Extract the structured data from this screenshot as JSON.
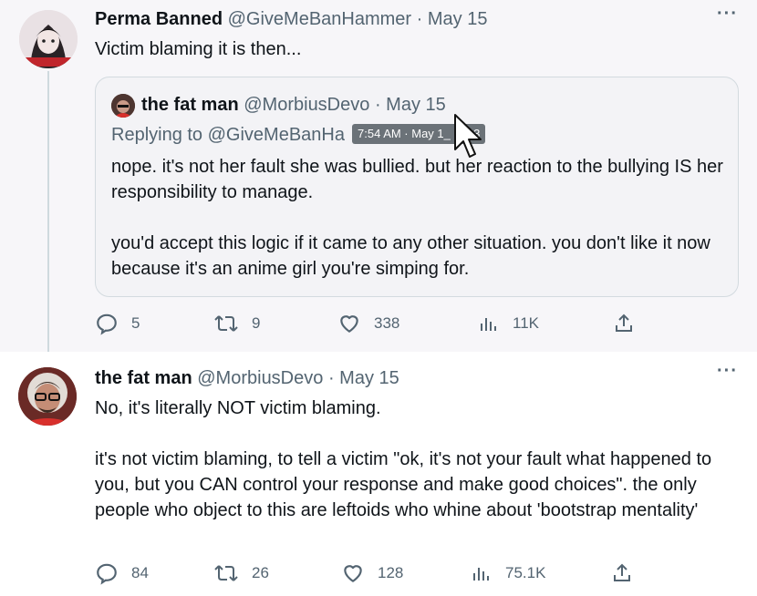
{
  "tweets": [
    {
      "author_name": "Perma Banned",
      "handle": "@GiveMeBanHammer",
      "date": "May 15",
      "text": "Victim blaming it is then...",
      "quote": {
        "author_name": "the fat man",
        "handle": "@MorbiusDevo",
        "date": "May 15",
        "replying_to": "Replying to @GiveMeBanHa",
        "tooltip": "7:54 AM · May 1_ 2023",
        "paragraphs": [
          "nope. it's not her fault she was bullied. but her reaction to the bullying IS her responsibility to manage.",
          "you'd accept this logic if it came to any other situation. you don't like it now because it's an anime girl you're simping for."
        ]
      },
      "stats": {
        "replies": "5",
        "retweets": "9",
        "likes": "338",
        "views": "11K"
      }
    },
    {
      "author_name": "the fat man",
      "handle": "@MorbiusDevo",
      "date": "May 15",
      "paragraphs": [
        "No, it's literally NOT victim blaming.",
        "it's not victim blaming, to tell a victim \"ok, it's not your fault what happened to you, but you CAN control your response and make good choices\". the only people who object to this are leftoids who whine about 'bootstrap mentality'"
      ],
      "stats": {
        "replies": "84",
        "retweets": "26",
        "likes": "128",
        "views": "75.1K"
      }
    }
  ],
  "ui": {
    "more_label": "···",
    "separator": "·"
  },
  "icons": [
    "reply-icon",
    "retweet-icon",
    "like-icon",
    "views-icon",
    "share-icon",
    "more-icon",
    "cursor-icon"
  ],
  "colors": {
    "text": "#0f1419",
    "muted": "#536471",
    "border": "#cfd9de",
    "tooltip": "#6b7278"
  }
}
